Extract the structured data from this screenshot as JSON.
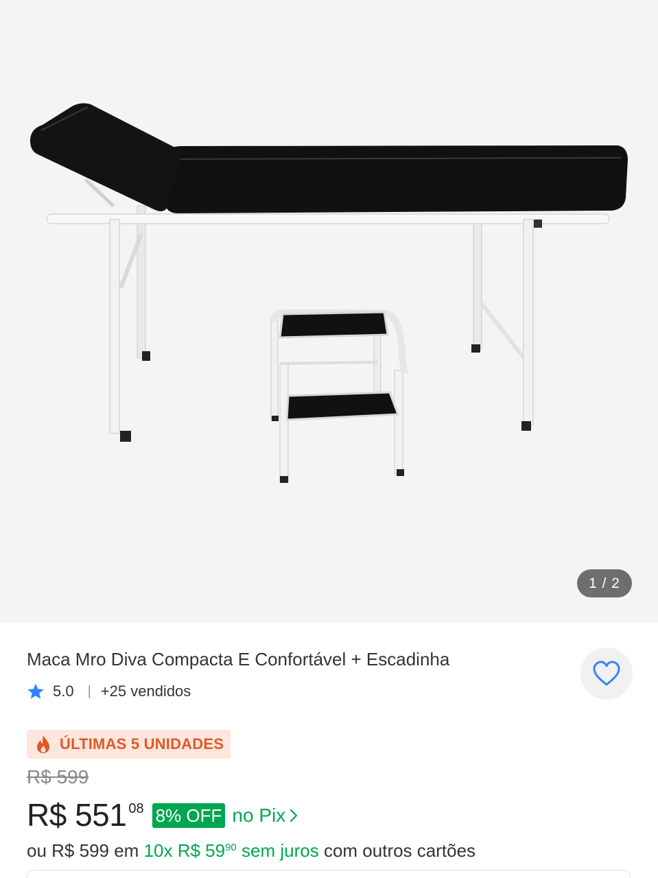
{
  "gallery": {
    "counter": "1 / 2",
    "background": "#f4f4f4"
  },
  "product": {
    "title": "Maca Mro Diva Compacta E Confortável + Escadinha",
    "rating": "5.0",
    "separator": "|",
    "sold": "+25 vendidos",
    "badge": "ÚLTIMAS 5 UNIDADES",
    "old_price": "R$ 599",
    "price": "R$ 551",
    "price_cents": "08",
    "discount": "8% OFF",
    "pix_label": "no Pix",
    "installments": {
      "prefix": "ou R$ 599 em",
      "plan": "10x R$ 59",
      "plan_cents": "90",
      "interest": "sem juros",
      "suffix": "com outros cartões"
    }
  },
  "icons": {
    "star": "star-icon",
    "heart": "heart-icon",
    "fire": "fire-icon",
    "chevron": "chevron-right-icon"
  },
  "colors": {
    "accent_green": "#00a650",
    "star_blue": "#3483fa",
    "badge_orange": "#e0592a",
    "badge_bg": "#fde6dc"
  }
}
